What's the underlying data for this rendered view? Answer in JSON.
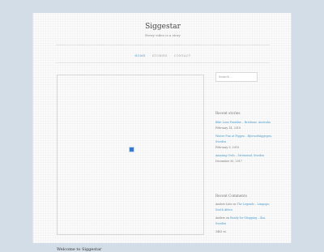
{
  "site": {
    "title": "Siggestar",
    "description": "Every video is a story"
  },
  "nav": {
    "items": [
      "Home",
      "Stories",
      "Contact"
    ],
    "active": 0
  },
  "search": {
    "placeholder": "Search …"
  },
  "recent_stories": {
    "title": "Recent stories",
    "items": [
      {
        "link": "Bike Lane Paradise – Brisbane, Australia",
        "date": "February 14, 2018"
      },
      {
        "link": "Winter Fun at Piggen – Björnorbäggegen, Sweden",
        "date": "February 9, 2018"
      },
      {
        "link": "Amazing Owls – Strömstad, Sweden",
        "date": "December 30, 2017"
      }
    ]
  },
  "recent_comments": {
    "title": "Recent Comments",
    "items": [
      {
        "author": "Anders Lutz",
        "on": "on",
        "link": "The Legends – Limpopo, South Africa"
      },
      {
        "author": "Anders",
        "on": "on",
        "link": "Ready for Shopping – Åsa, Sweden"
      }
    ],
    "extra": "3463 ec."
  },
  "post": {
    "title": "Welcome to Siggestar"
  },
  "colors": {
    "accent": "#4a9ac7",
    "background": "#d3dde7"
  }
}
